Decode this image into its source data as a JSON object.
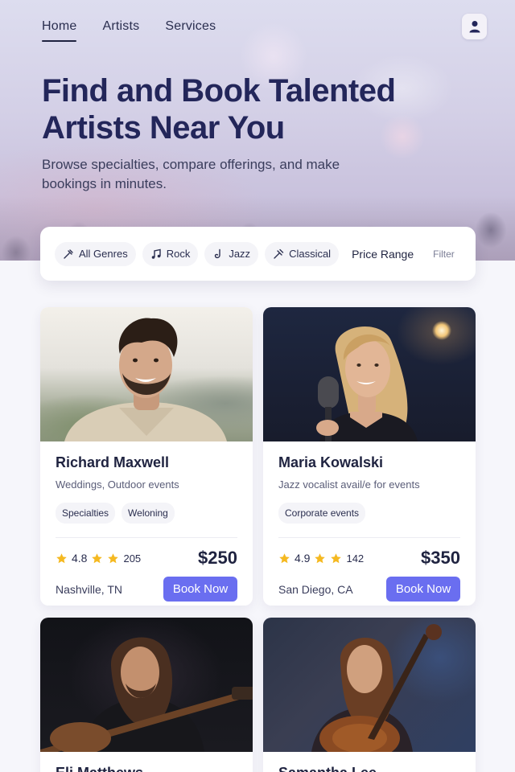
{
  "nav": {
    "links": [
      "Home",
      "Artists",
      "Services"
    ],
    "active": "Home",
    "profile_icon": "user-icon"
  },
  "hero": {
    "title": "Find and Book Talented Artists Near You",
    "subtitle": "Browse specialties, compare offerings, and make bookings in minutes."
  },
  "filters": {
    "chips": [
      {
        "label": "All Genres",
        "icon": "guitar-pick-icon"
      },
      {
        "label": "Rock",
        "icon": "music-note-icon"
      },
      {
        "label": "Jazz",
        "icon": "saxophone-icon"
      },
      {
        "label": "Classical",
        "icon": "violin-icon"
      }
    ],
    "price_range": "Price Range",
    "filter": "Filter"
  },
  "artists": [
    {
      "name": "Richard Maxwell",
      "description": "Weddings, Outdoor events",
      "tags": [
        "Specialties",
        "Weloning"
      ],
      "rating": "4.8",
      "reviews": "205",
      "price": "$250",
      "location": "Nashville, TN",
      "button": "Book Now"
    },
    {
      "name": "Maria Kowalski",
      "description": "Jazz vocalist avail/e for events",
      "tags": [
        "Corporate events"
      ],
      "rating": "4.9",
      "reviews": "142",
      "price": "$350",
      "location": "San Diego, CA",
      "button": "Book Now"
    },
    {
      "name": "Eli Matthews"
    },
    {
      "name": "Samantha Lee"
    }
  ],
  "colors": {
    "accent": "#6a6ef0",
    "heading": "#23265a",
    "star": "#f5b921"
  }
}
